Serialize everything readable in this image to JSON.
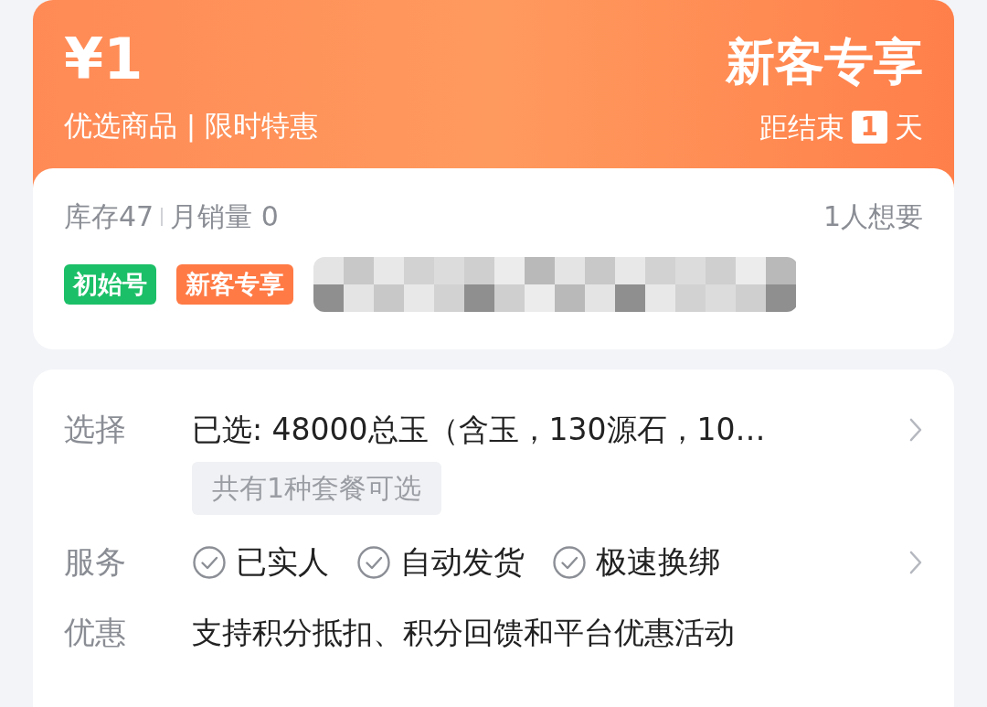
{
  "banner": {
    "price": "¥1",
    "subtitle": "优选商品 | 限时特惠",
    "badge": "新客专享",
    "countdown": {
      "prefix": "距结束",
      "value": "1",
      "suffix": "天"
    }
  },
  "stats": {
    "stock": "库存47",
    "monthly_sales": "月销量 0",
    "wants": "1人想要"
  },
  "tags": [
    {
      "label": "初始号",
      "color": "#1bbf67"
    },
    {
      "label": "新客专享",
      "color": "#ff7a45"
    }
  ],
  "details": [
    {
      "kind": "select",
      "label": "选择",
      "value": "已选: 48000总玉（含玉，130源石，10…",
      "note": "共有1种套餐可选",
      "chevron": true
    },
    {
      "kind": "services",
      "label": "服务",
      "items": [
        "已实人",
        "自动发货",
        "极速换绑"
      ],
      "chevron": true
    },
    {
      "kind": "text",
      "label": "优惠",
      "value": "支持积分抵扣、积分回馈和平台优惠活动",
      "chevron": false
    }
  ]
}
